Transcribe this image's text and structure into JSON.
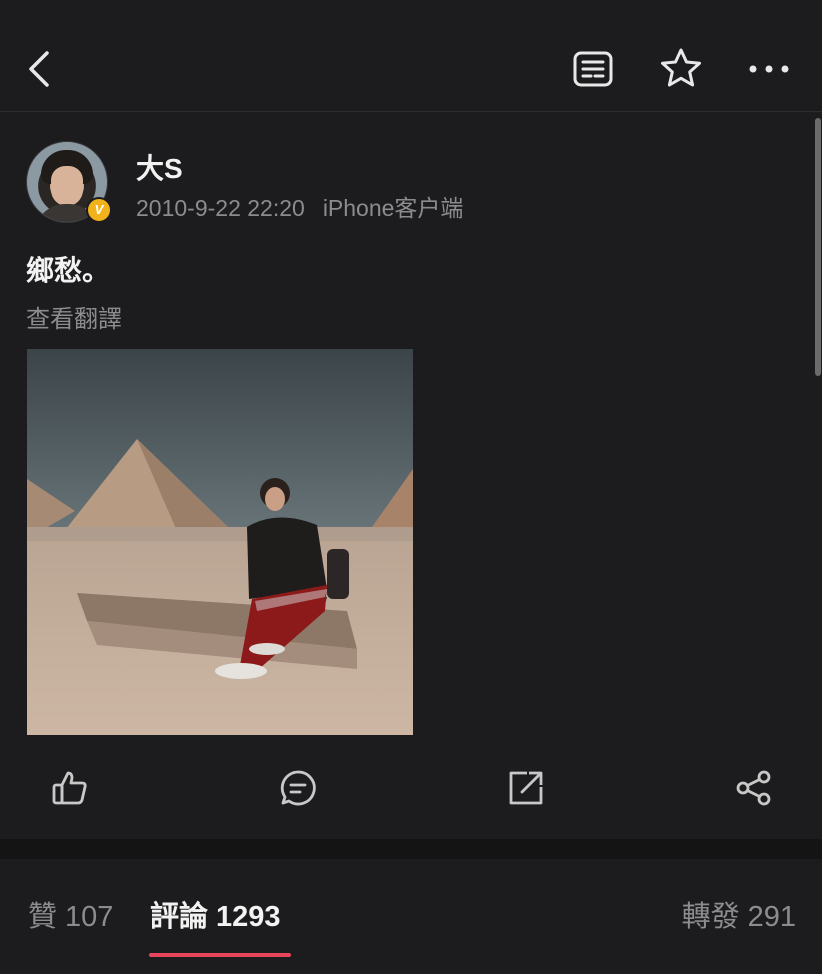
{
  "header": {
    "back_icon": "chevron-left-icon",
    "reader_icon": "reader-mode-icon",
    "favorite_icon": "star-icon",
    "more_icon": "more-horizontal-icon"
  },
  "post": {
    "author": "大S",
    "verified_badge": "V",
    "timestamp": "2010-9-22 22:20",
    "source": "iPhone客户端",
    "text": "鄉愁。",
    "translate_link": "查看翻譯"
  },
  "actions": {
    "like_icon": "thumbs-up-icon",
    "comment_icon": "comment-icon",
    "forward_icon": "forward-icon",
    "share_icon": "share-icon"
  },
  "tabs": {
    "likes_label": "贊",
    "likes_count": "107",
    "comments_label": "評論",
    "comments_count": "1293",
    "reposts_label": "轉發",
    "reposts_count": "291"
  },
  "colors": {
    "background": "#1c1c1e",
    "accent": "#e8455d",
    "badge": "#f2b21b",
    "secondary_text": "#8c8c8e"
  }
}
